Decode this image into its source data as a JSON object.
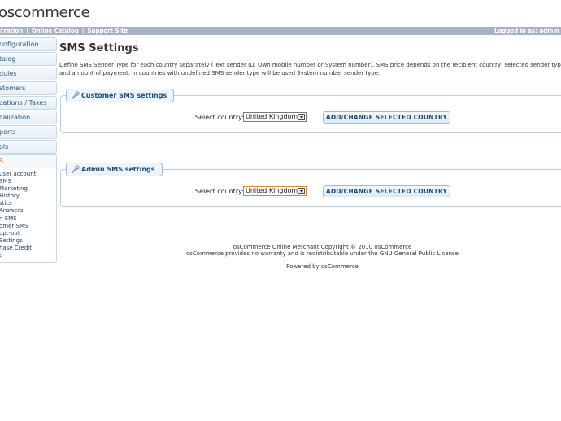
{
  "header": {
    "logo_text": "oscommerce",
    "links": [
      "stration",
      "Online Catalog",
      "Support Site"
    ],
    "link_separator": "|",
    "login_text": "Logged in as: admin (l"
  },
  "sidebar": {
    "items": [
      "onfiguration",
      "talog",
      "dules",
      "stomers",
      "cations / Taxes",
      "calization",
      "ports",
      "ols"
    ],
    "sms_heading": "S",
    "sms_items": [
      "user account",
      "SMS",
      "Marketing",
      "History",
      "stics",
      "Answers",
      "n SMS",
      "omer SMS",
      "opt-out",
      "Settings",
      "hase Credit",
      "t"
    ]
  },
  "main": {
    "title": "SMS Settings",
    "description": "Define SMS Sender Type for each country separately (Text sender ID, Own mobile number or System number). SMS price depends on the recipient country, selected sender type and amount of payment. In countries with undefined SMS sender type will be used System number sender type.",
    "customer_panel": {
      "title": "Customer SMS settings",
      "select_label": "Select country:",
      "selected_country": "United Kingdom",
      "button_label": "ADD/CHANGE SELECTED COUNTRY"
    },
    "admin_panel": {
      "title": "Admin SMS settings",
      "select_label": "Select country:",
      "selected_country": "United Kingdom",
      "button_label": "ADD/CHANGE SELECTED COUNTRY"
    }
  },
  "footer": {
    "copyright": "osCommerce Online Merchant Copyright © 2010 osCommerce",
    "license": "osCommerce provides no warranty and is redistributable under the GNU General Public License",
    "powered": "Powered by osCommerce"
  },
  "colors": {
    "topbar": "#a9b2c3",
    "panel_border": "#b8cfe0",
    "link_blue": "#2b5b85",
    "active_orange": "#e07b1a"
  }
}
